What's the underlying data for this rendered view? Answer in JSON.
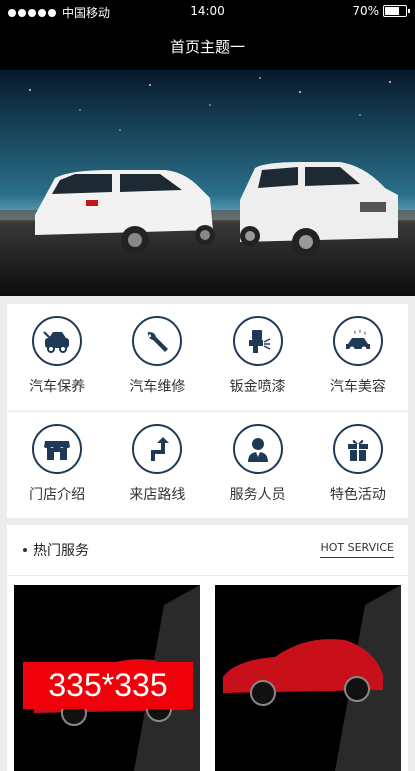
{
  "status": {
    "carrier": "中国移动",
    "time": "14:00",
    "battery": "70%",
    "battery_level": 0.7
  },
  "header": {
    "title": "首页主题一"
  },
  "services": [
    {
      "label": "汽车保养",
      "icon": "car-maintenance-icon"
    },
    {
      "label": "汽车维修",
      "icon": "wrench-icon"
    },
    {
      "label": "钣金喷漆",
      "icon": "spray-gun-icon"
    },
    {
      "label": "汽车美容",
      "icon": "car-wash-icon"
    },
    {
      "label": "门店介绍",
      "icon": "store-icon"
    },
    {
      "label": "来店路线",
      "icon": "route-icon"
    },
    {
      "label": "服务人员",
      "icon": "staff-icon"
    },
    {
      "label": "特色活动",
      "icon": "gift-icon"
    }
  ],
  "hot": {
    "title": "热门服务",
    "subtitle": "HOT SERVICE"
  },
  "products": [
    {
      "placeholder": "335*335"
    },
    {
      "placeholder": ""
    }
  ],
  "colors": {
    "accent": "#1f3a57",
    "placeholder_red": "#f0000a"
  }
}
